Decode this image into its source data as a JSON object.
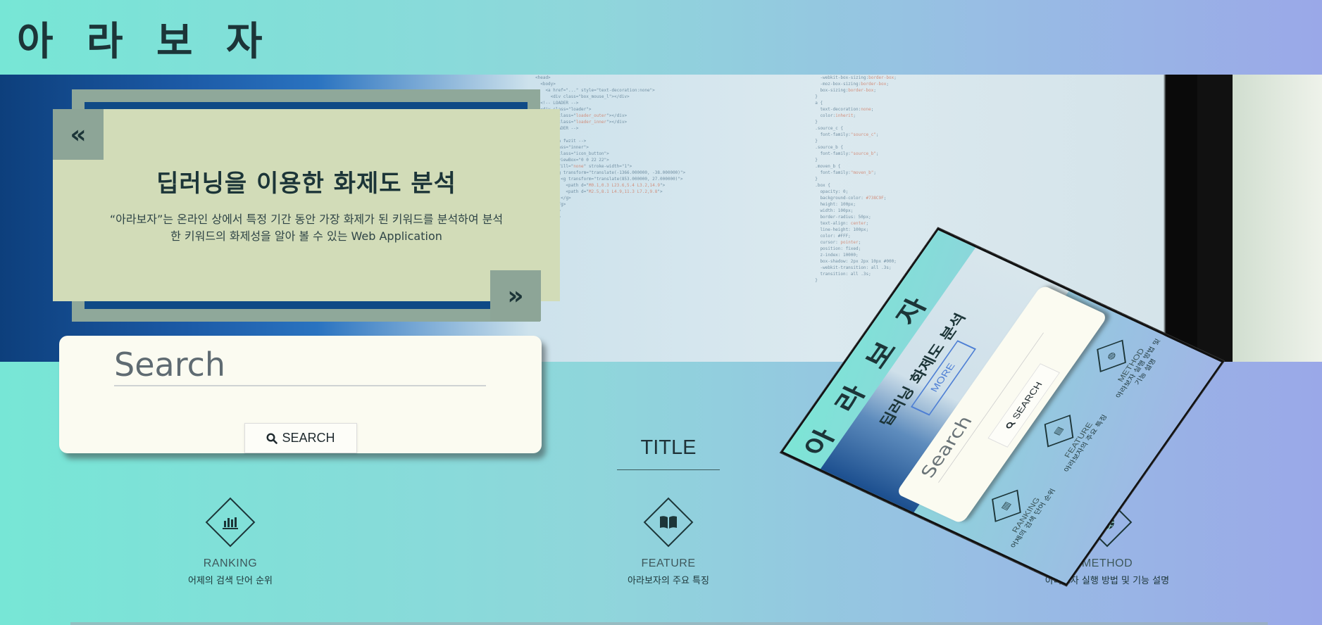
{
  "header": {
    "logo": "아 라 보 자"
  },
  "slider": {
    "prev_label": "«",
    "next_label": "»",
    "title": "딥러닝을 이용한 화제도 분석",
    "description": "“아라보자”는 온라인 상에서 특정 기간 동안 가장 화제가 된 키워드를 분석하여 분석한 키워드의 화제성을 알아 볼 수 있는 Web Application"
  },
  "search": {
    "placeholder": "Search",
    "button_label": "SEARCH"
  },
  "section": {
    "title": "TITLE"
  },
  "features": [
    {
      "icon": "bar-chart-icon",
      "name": "RANKING",
      "desc": "어제의 검색 단어 순위"
    },
    {
      "icon": "book-icon",
      "name": "FEATURE",
      "desc": "아라보자의 주요 특징"
    },
    {
      "icon": "globe-icon",
      "name": "METHOD",
      "desc": "아라보자 실행 방법 및 기능 설명"
    }
  ],
  "mockup": {
    "logo": "아 라 보 자",
    "hero_title": "딥러닝 화제도 분석",
    "more_label": "MORE",
    "search_placeholder": "Search",
    "search_button": "SEARCH",
    "features": [
      {
        "name": "RANKING",
        "desc": "어제의 검색 단어 순위"
      },
      {
        "name": "FEATURE",
        "desc": "아라보자의 주요 특징"
      },
      {
        "name": "METHOD",
        "desc": "아라보자 실행 방법 및 기능 설명"
      }
    ]
  },
  "colors": {
    "gradient_start": "#77e6d6",
    "gradient_end": "#9aa8e8",
    "slide_bg": "#d2dcb8",
    "slide_accent": "#8da597",
    "text_dark": "#1c3538",
    "card_bg": "#fbfbf1"
  }
}
